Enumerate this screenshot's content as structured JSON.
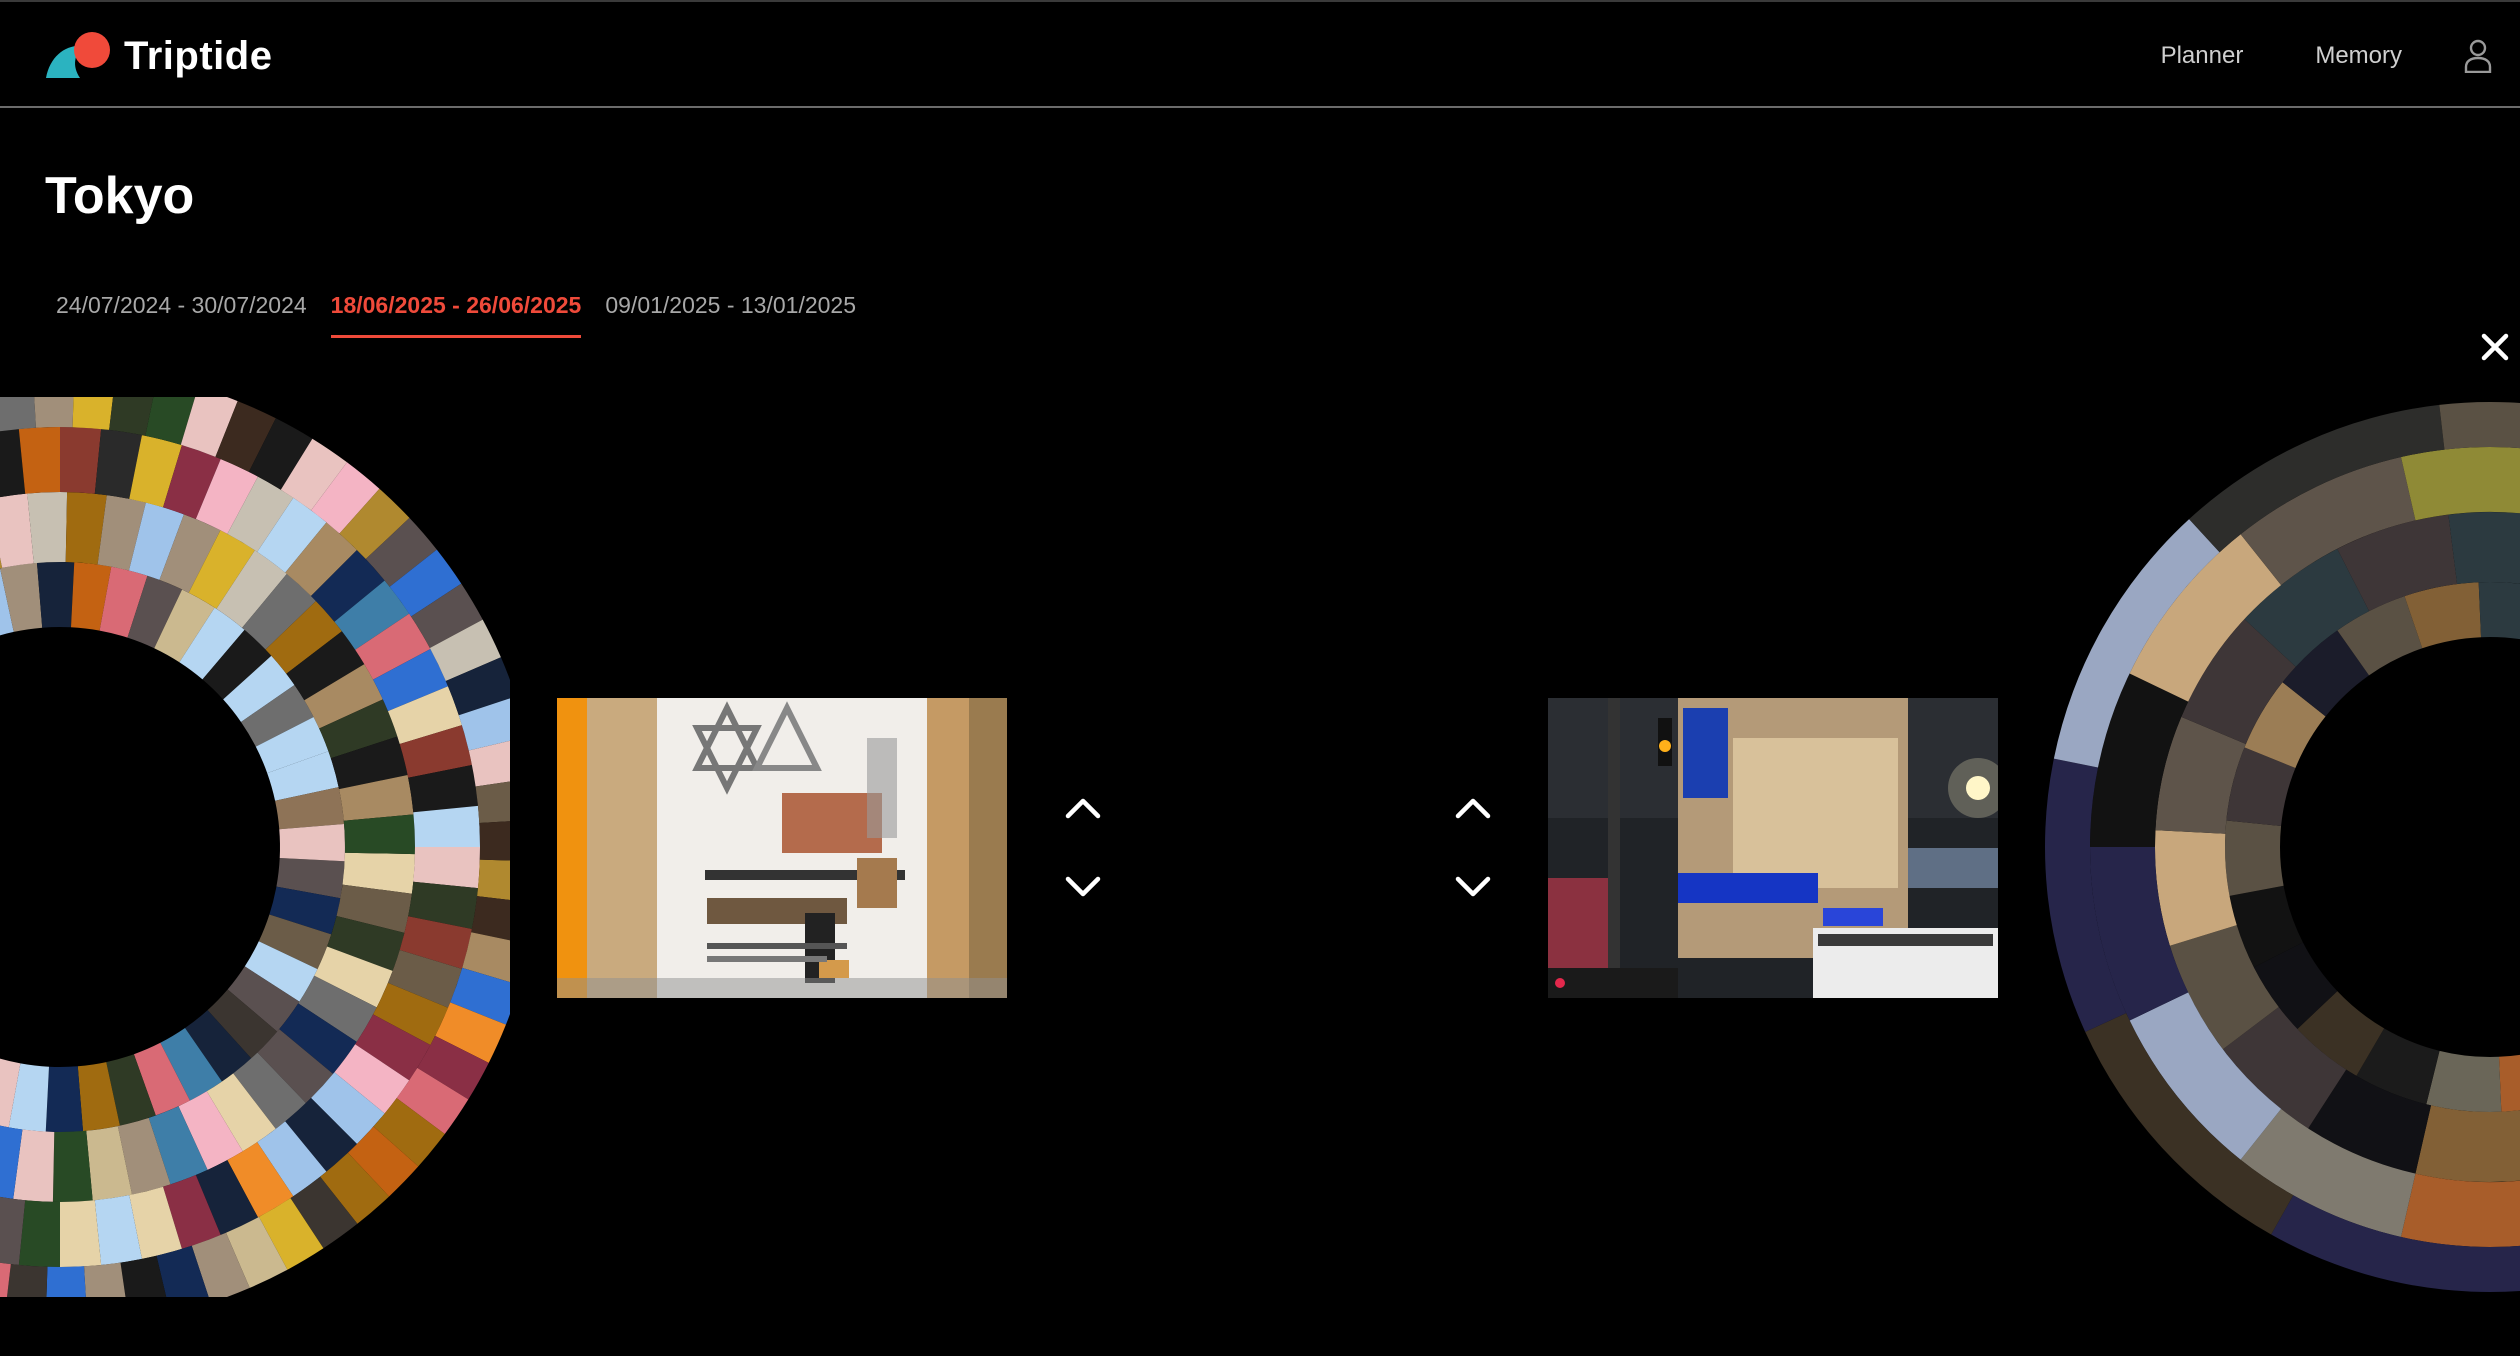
{
  "app": {
    "brand_name": "Triptide",
    "brand_colors": {
      "wave": "#2bb3c0",
      "sun": "#f04a3a"
    }
  },
  "nav": {
    "planner_label": "Planner",
    "memory_label": "Memory",
    "user_icon": "user-icon"
  },
  "page": {
    "title": "Tokyo"
  },
  "tabs": [
    {
      "label": "24/07/2024 - 30/07/2024",
      "active": false
    },
    {
      "label": "18/06/2025 - 26/06/2025",
      "active": true
    },
    {
      "label": "09/01/2025 - 13/01/2025",
      "active": false
    }
  ],
  "colors": {
    "accent": "#ef4a3a",
    "background": "#000000"
  },
  "controls": {
    "close_icon": "close-icon",
    "up_icon": "chevron-up-icon",
    "down_icon": "chevron-down-icon"
  }
}
